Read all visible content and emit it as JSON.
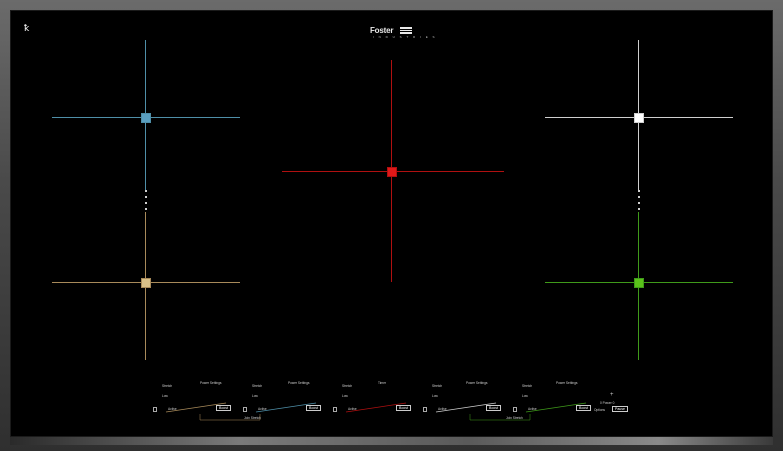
{
  "brand": {
    "name": "Foster",
    "tagline": "I N D U S T R I E S"
  },
  "header": {
    "power_glyph": "ꝁ"
  },
  "colors": {
    "zone_top_left": "#5a9fc0",
    "zone_bottom_left": "#d9c088",
    "zone_center": "#e01818",
    "zone_top_right": "#ffffff",
    "zone_bottom_right": "#5ac21a",
    "line_top_left": "#4f8fa8",
    "line_bottom_left": "#a88a5a",
    "line_center": "#b01010",
    "line_top_right": "#cfcfcf",
    "line_bottom_right": "#3f9a1a"
  },
  "zones": [
    {
      "name": "zone-top-left"
    },
    {
      "name": "zone-bottom-left"
    },
    {
      "name": "zone-center"
    },
    {
      "name": "zone-top-right"
    },
    {
      "name": "zone-bottom-right"
    }
  ],
  "controls": [
    {
      "left_label": "Stretch",
      "right_label": "Power Settings",
      "sub_label": "Low",
      "slider_label": "Active",
      "boost": "Boost",
      "link_label": ""
    },
    {
      "left_label": "Stretch",
      "right_label": "Power Settings",
      "sub_label": "Low",
      "slider_label": "Active",
      "boost": "Boost",
      "link_label": "Join Stretch"
    },
    {
      "left_label": "Stretch",
      "right_label": "Timer",
      "sub_label": "Low",
      "slider_label": "Active",
      "boost": "Boost",
      "link_label": ""
    },
    {
      "left_label": "Stretch",
      "right_label": "Power Settings",
      "sub_label": "Low",
      "slider_label": "Active",
      "boost": "Boost",
      "link_label": "Join Stretch"
    },
    {
      "left_label": "Stretch",
      "right_label": "Power Settings",
      "sub_label": "Low",
      "slider_label": "Active",
      "boost": "Boost",
      "link_label": ""
    }
  ],
  "extra": {
    "timer_plus": "+",
    "timer_label": "0 Power 0",
    "options_label": "Options",
    "pause_label": "Pause"
  }
}
